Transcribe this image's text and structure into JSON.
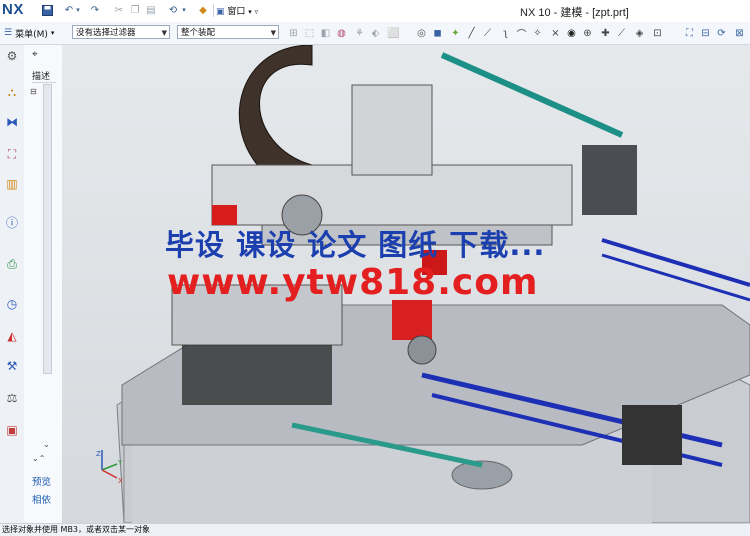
{
  "app": {
    "logo": "NX",
    "title": "NX 10 - 建模 - [zpt.prt]"
  },
  "quick_access": {
    "window_menu": "窗口"
  },
  "toolbar": {
    "menu_label": "菜单(M)",
    "selection_filter": "没有选择过滤器",
    "selection_scope": "整个装配"
  },
  "navigator": {
    "header_icon": "gear-icon",
    "column_label": "描述",
    "preview_link": "预览",
    "dependency_link": "相依"
  },
  "viewport": {
    "watermark_line1": "毕设 课设 论文 图纸 下载...",
    "watermark_line2": "www.ytw818.com",
    "triad_label_z": "Z",
    "triad_label_y": "Y",
    "triad_label_x": "X"
  },
  "status": {
    "message": "选择对象并使用 MB3，或者双击某一对象"
  },
  "colors": {
    "logo": "#1e4f8f",
    "watermark_blue": "#1b3fae",
    "watermark_red": "#e41f1f",
    "link": "#1f5fb0"
  }
}
